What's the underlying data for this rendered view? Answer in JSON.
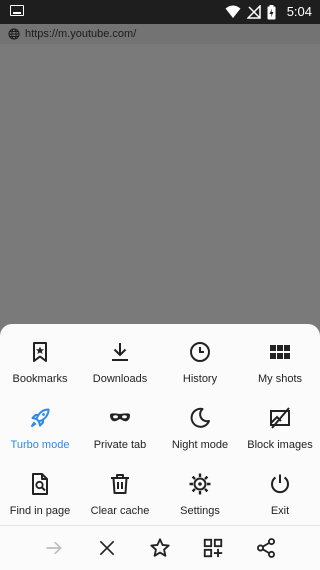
{
  "status_bar": {
    "time": "5:04"
  },
  "url_bar": {
    "url": "https://m.youtube.com/"
  },
  "menu": {
    "rows": [
      [
        {
          "label": "Bookmarks",
          "icon": "bookmark-star-icon"
        },
        {
          "label": "Downloads",
          "icon": "download-icon"
        },
        {
          "label": "History",
          "icon": "clock-icon"
        },
        {
          "label": "My shots",
          "icon": "grid-icon"
        }
      ],
      [
        {
          "label": "Turbo mode",
          "icon": "rocket-icon",
          "active": true
        },
        {
          "label": "Private tab",
          "icon": "mask-icon"
        },
        {
          "label": "Night mode",
          "icon": "moon-icon"
        },
        {
          "label": "Block images",
          "icon": "no-image-icon"
        }
      ],
      [
        {
          "label": "Find in page",
          "icon": "find-in-page-icon"
        },
        {
          "label": "Clear cache",
          "icon": "trash-icon"
        },
        {
          "label": "Settings",
          "icon": "gear-icon"
        },
        {
          "label": "Exit",
          "icon": "power-icon"
        }
      ]
    ]
  },
  "bottom_bar": [
    "forward-arrow-icon",
    "close-icon",
    "star-icon",
    "add-apps-icon",
    "share-icon"
  ],
  "colors": {
    "accent": "#2d8ae8",
    "sheet": "#fbfbfb",
    "page_overlay": "#7a7a7a",
    "status_bar": "#1e1e1e"
  }
}
